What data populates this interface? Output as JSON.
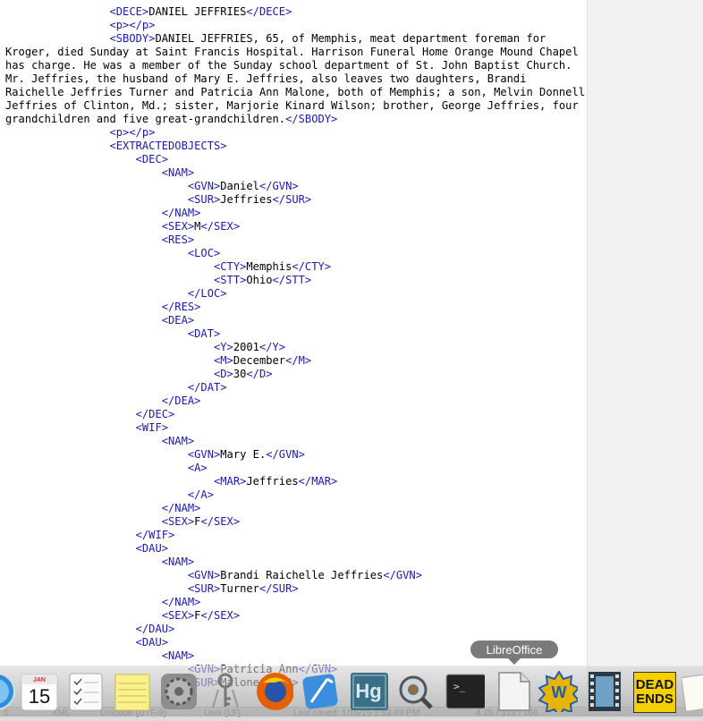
{
  "editor": {
    "lines": [
      {
        "indent": "                ",
        "open": "<DECE>",
        "text": "DANIEL JEFFRIES",
        "close": "</DECE>"
      },
      {
        "indent": "                ",
        "open": "<p>",
        "text": "",
        "close": "</p>"
      },
      {
        "indent": "",
        "open": "",
        "text": "",
        "close": "",
        "sbody": true
      },
      {
        "indent": "                ",
        "open": "<p>",
        "text": "",
        "close": "</p>"
      },
      {
        "indent": "                ",
        "open": "<EXTRACTEDOBJECTS>",
        "text": "",
        "close": ""
      },
      {
        "indent": "                    ",
        "open": "<DEC>",
        "text": "",
        "close": ""
      },
      {
        "indent": "                        ",
        "open": "<NAM>",
        "text": "",
        "close": ""
      },
      {
        "indent": "                            ",
        "open": "<GVN>",
        "text": "Daniel",
        "close": "</GVN>"
      },
      {
        "indent": "                            ",
        "open": "<SUR>",
        "text": "Jeffries",
        "close": "</SUR>"
      },
      {
        "indent": "                        ",
        "open": "</NAM>",
        "text": "",
        "close": ""
      },
      {
        "indent": "                        ",
        "open": "<SEX>",
        "text": "M",
        "close": "</SEX>"
      },
      {
        "indent": "                        ",
        "open": "<RES>",
        "text": "",
        "close": ""
      },
      {
        "indent": "                            ",
        "open": "<LOC>",
        "text": "",
        "close": ""
      },
      {
        "indent": "                                ",
        "open": "<CTY>",
        "text": "Memphis",
        "close": "</CTY>"
      },
      {
        "indent": "                                ",
        "open": "<STT>",
        "text": "Ohio",
        "close": "</STT>"
      },
      {
        "indent": "                            ",
        "open": "</LOC>",
        "text": "",
        "close": ""
      },
      {
        "indent": "                        ",
        "open": "</RES>",
        "text": "",
        "close": ""
      },
      {
        "indent": "                        ",
        "open": "<DEA>",
        "text": "",
        "close": ""
      },
      {
        "indent": "                            ",
        "open": "<DAT>",
        "text": "",
        "close": ""
      },
      {
        "indent": "                                ",
        "open": "<Y>",
        "text": "2001",
        "close": "</Y>"
      },
      {
        "indent": "                                ",
        "open": "<M>",
        "text": "December",
        "close": "</M>"
      },
      {
        "indent": "                                ",
        "open": "<D>",
        "text": "30",
        "close": "</D>"
      },
      {
        "indent": "                            ",
        "open": "</DAT>",
        "text": "",
        "close": ""
      },
      {
        "indent": "                        ",
        "open": "</DEA>",
        "text": "",
        "close": ""
      },
      {
        "indent": "                    ",
        "open": "</DEC>",
        "text": "",
        "close": ""
      },
      {
        "indent": "                    ",
        "open": "<WIF>",
        "text": "",
        "close": ""
      },
      {
        "indent": "                        ",
        "open": "<NAM>",
        "text": "",
        "close": ""
      },
      {
        "indent": "                            ",
        "open": "<GVN>",
        "text": "Mary E.",
        "close": "</GVN>"
      },
      {
        "indent": "                            ",
        "open": "<A>",
        "text": "",
        "close": ""
      },
      {
        "indent": "                                ",
        "open": "<MAR>",
        "text": "Jeffries",
        "close": "</MAR>"
      },
      {
        "indent": "                            ",
        "open": "</A>",
        "text": "",
        "close": ""
      },
      {
        "indent": "                        ",
        "open": "</NAM>",
        "text": "",
        "close": ""
      },
      {
        "indent": "                        ",
        "open": "<SEX>",
        "text": "F",
        "close": "</SEX>"
      },
      {
        "indent": "                    ",
        "open": "</WIF>",
        "text": "",
        "close": ""
      },
      {
        "indent": "                    ",
        "open": "<DAU>",
        "text": "",
        "close": ""
      },
      {
        "indent": "                        ",
        "open": "<NAM>",
        "text": "",
        "close": ""
      },
      {
        "indent": "                            ",
        "open": "<GVN>",
        "text": "Brandi Raichelle Jeffries",
        "close": "</GVN>"
      },
      {
        "indent": "                            ",
        "open": "<SUR>",
        "text": "Turner",
        "close": "</SUR>"
      },
      {
        "indent": "                        ",
        "open": "</NAM>",
        "text": "",
        "close": ""
      },
      {
        "indent": "                        ",
        "open": "<SEX>",
        "text": "F",
        "close": "</SEX>"
      },
      {
        "indent": "                    ",
        "open": "</DAU>",
        "text": "",
        "close": ""
      },
      {
        "indent": "                    ",
        "open": "<DAU>",
        "text": "",
        "close": ""
      },
      {
        "indent": "                        ",
        "open": "<NAM>",
        "text": "",
        "close": ""
      },
      {
        "indent": "                            ",
        "open": "<GVN>",
        "text": "Patricia Ann",
        "close": "</GVN>"
      },
      {
        "indent": "                            ",
        "open": "<SUR>",
        "text": "Malone",
        "close": "</SUR>"
      }
    ],
    "sbody_indent": "                ",
    "sbody_open": "<SBODY>",
    "sbody_text": "DANIEL JEFFRIES, 65, of Memphis, meat department foreman for Kroger, died Sunday at Saint Francis Hospital. Harrison Funeral Home Orange Mound Chapel has charge. He was a member of the Sunday school department of St. John Baptist Church. Mr. Jeffries, the husband of Mary E. Jeffries, also leaves two daughters, Brandi Raichelle Jeffries Turner and Patricia Ann Malone, both of Memphis; a son, Melvin Donnell Jeffries of Clinton, Md.; sister, Marjorie Kinard Wilson; brother, George Jeffries, four grandchildren and five great-grandchildren.",
    "sbody_close": "</SBODY>",
    "tag_color": "#1a1ab0",
    "text_color": "#000000"
  },
  "status_bar": {
    "line_col": "1",
    "syntax": "XML",
    "encoding": "Unicode (UTF-8)",
    "line_endings": "Unix (LF)",
    "last_saved": "Last saved: 1/15/15 1:52:49 PM",
    "position": "4.25 / 313 / 108"
  },
  "dock": {
    "tooltip": "LibreOffice",
    "calendar_month": "JAN",
    "calendar_day": "15",
    "hg_label": "Hg",
    "terminal_prompt": ">_",
    "deadends_line1": "DEAD",
    "deadends_line2": "ENDS",
    "icons": [
      {
        "name": "safari-icon"
      },
      {
        "name": "calendar-icon"
      },
      {
        "name": "reminders-icon"
      },
      {
        "name": "notes-icon"
      },
      {
        "name": "system-preferences-icon"
      },
      {
        "name": "keychain-icon"
      },
      {
        "name": "firefox-icon"
      },
      {
        "name": "xcode-icon"
      },
      {
        "name": "mercurial-icon"
      },
      {
        "name": "grab-icon"
      },
      {
        "name": "terminal-icon"
      },
      {
        "name": "libreoffice-icon"
      },
      {
        "name": "wunderlist-icon"
      },
      {
        "name": "video-icon"
      },
      {
        "name": "dead-ends-icon"
      },
      {
        "name": "document-icon"
      }
    ]
  }
}
